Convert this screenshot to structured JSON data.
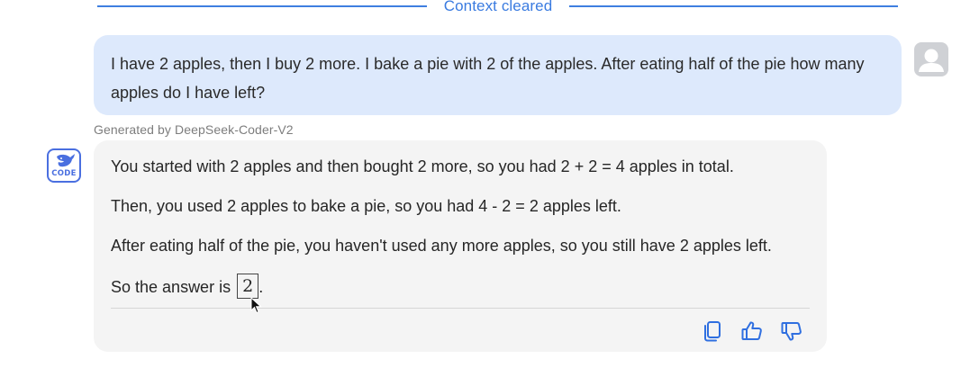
{
  "divider": {
    "label": "Context cleared"
  },
  "user_message": {
    "text": "I have 2 apples, then I buy 2 more. I bake a pie with 2 of the apples. After eating half of the pie how many apples do I have left?"
  },
  "generated_by": "Generated by DeepSeek-Coder-V2",
  "bot_avatar": {
    "icon": "whale-icon",
    "label": "CODE"
  },
  "bot_message": {
    "line1": "You started with 2 apples and then bought 2 more, so you had 2 + 2 = 4 apples in total.",
    "line2": "Then, you used 2 apples to bake a pie, so you had 4 - 2 = 2 apples left.",
    "line3": "After eating half of the pie, you haven't used any more apples, so you still have 2 apples left.",
    "line4_prefix": "So the answer is",
    "answer": "2",
    "line4_suffix": "."
  },
  "actions": {
    "copy_icon": "copy-icon",
    "like_icon": "thumbs-up-icon",
    "dislike_icon": "thumbs-down-icon"
  },
  "colors": {
    "accent": "#3a7be0",
    "user_bubble": "#dde9fc",
    "bot_bubble": "#f4f4f4",
    "avatar_grey": "#cfd1d5",
    "logo_blue": "#4a6fe0"
  }
}
